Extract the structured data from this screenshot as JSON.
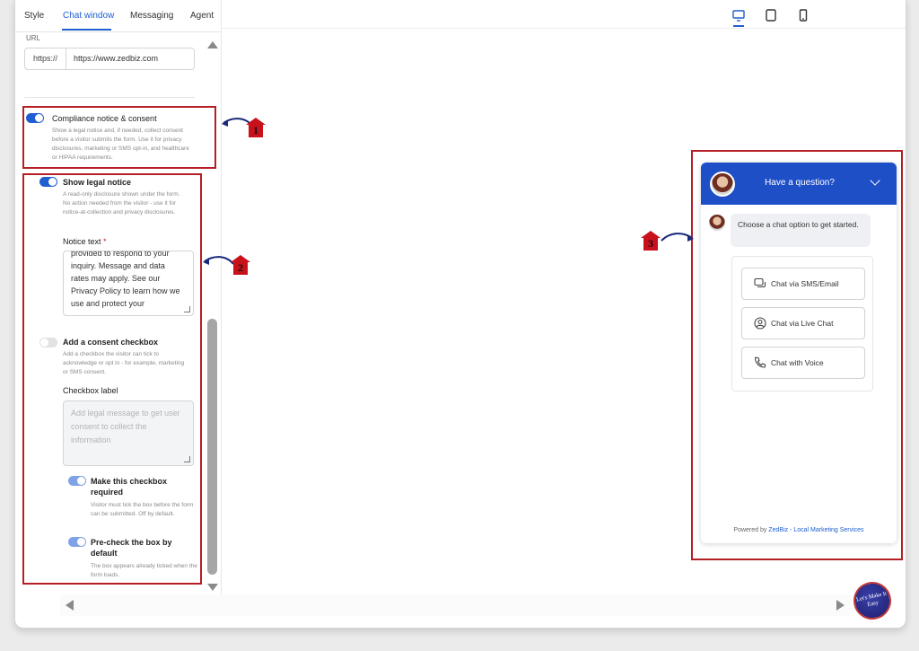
{
  "tabs": [
    {
      "label": "Style",
      "active": false
    },
    {
      "label": "Chat window",
      "active": true
    },
    {
      "label": "Messaging",
      "active": false
    },
    {
      "label": "Agent",
      "active": false
    }
  ],
  "url_field": {
    "label": "URL",
    "prefix": "https://",
    "value": "https://www.zedbiz.com"
  },
  "compliance": {
    "title": "Compliance notice & consent",
    "enabled": true,
    "description": "Show a legal notice and, if needed, collect consent before a visitor submits the form. Use it for privacy disclosures, marketing or SMS opt-in, and healthcare or HIPAA requirements."
  },
  "legal_notice": {
    "title": "Show legal notice",
    "enabled": true,
    "description": "A read-only disclosure shown under the form. No action needed from the visitor - use it for notice-at-collection and privacy disclosures.",
    "notice_label": "Notice text",
    "required_mark": "*",
    "notice_text": "provided to respond to your\ninquiry. Message and data\nrates may apply. See our\nPrivacy Policy to learn how we\nuse and protect your"
  },
  "consent_checkbox": {
    "title": "Add a consent checkbox",
    "enabled": false,
    "description": "Add a checkbox the visitor can tick to acknowledge or opt in - for example, marketing or SMS consent.",
    "checkbox_label": "Checkbox label",
    "placeholder": "Add legal message to get user\nconsent to collect the\ninformation",
    "required_option": {
      "title": "Make this checkbox\nrequired",
      "description": "Visitor must tick the box before the form can be submitted. Off by default."
    },
    "precheck_option": {
      "title": "Pre-check the box by\ndefault",
      "description": "The box appears already ticked when the form loads."
    }
  },
  "annotations": [
    "1",
    "2",
    "3"
  ],
  "device_icons": [
    "desktop-icon",
    "tablet-icon",
    "mobile-icon"
  ],
  "chat": {
    "header_title": "Have a question?",
    "greeting": "Choose a chat option to get started.",
    "options": [
      {
        "label": "Chat via SMS/Email",
        "icon": "chat-bubble-icon"
      },
      {
        "label": "Chat via Live Chat",
        "icon": "person-icon"
      },
      {
        "label": "Chat with Voice",
        "icon": "phone-icon"
      }
    ],
    "powered_by": "Powered by",
    "powered_link": "ZedBiz - Local Marketing Services"
  },
  "logo_badge": "Let's Make It Easy",
  "colors": {
    "accent": "#1f5fd1",
    "annotation_red": "#b51e24",
    "chat_header": "#1f4fc7"
  }
}
